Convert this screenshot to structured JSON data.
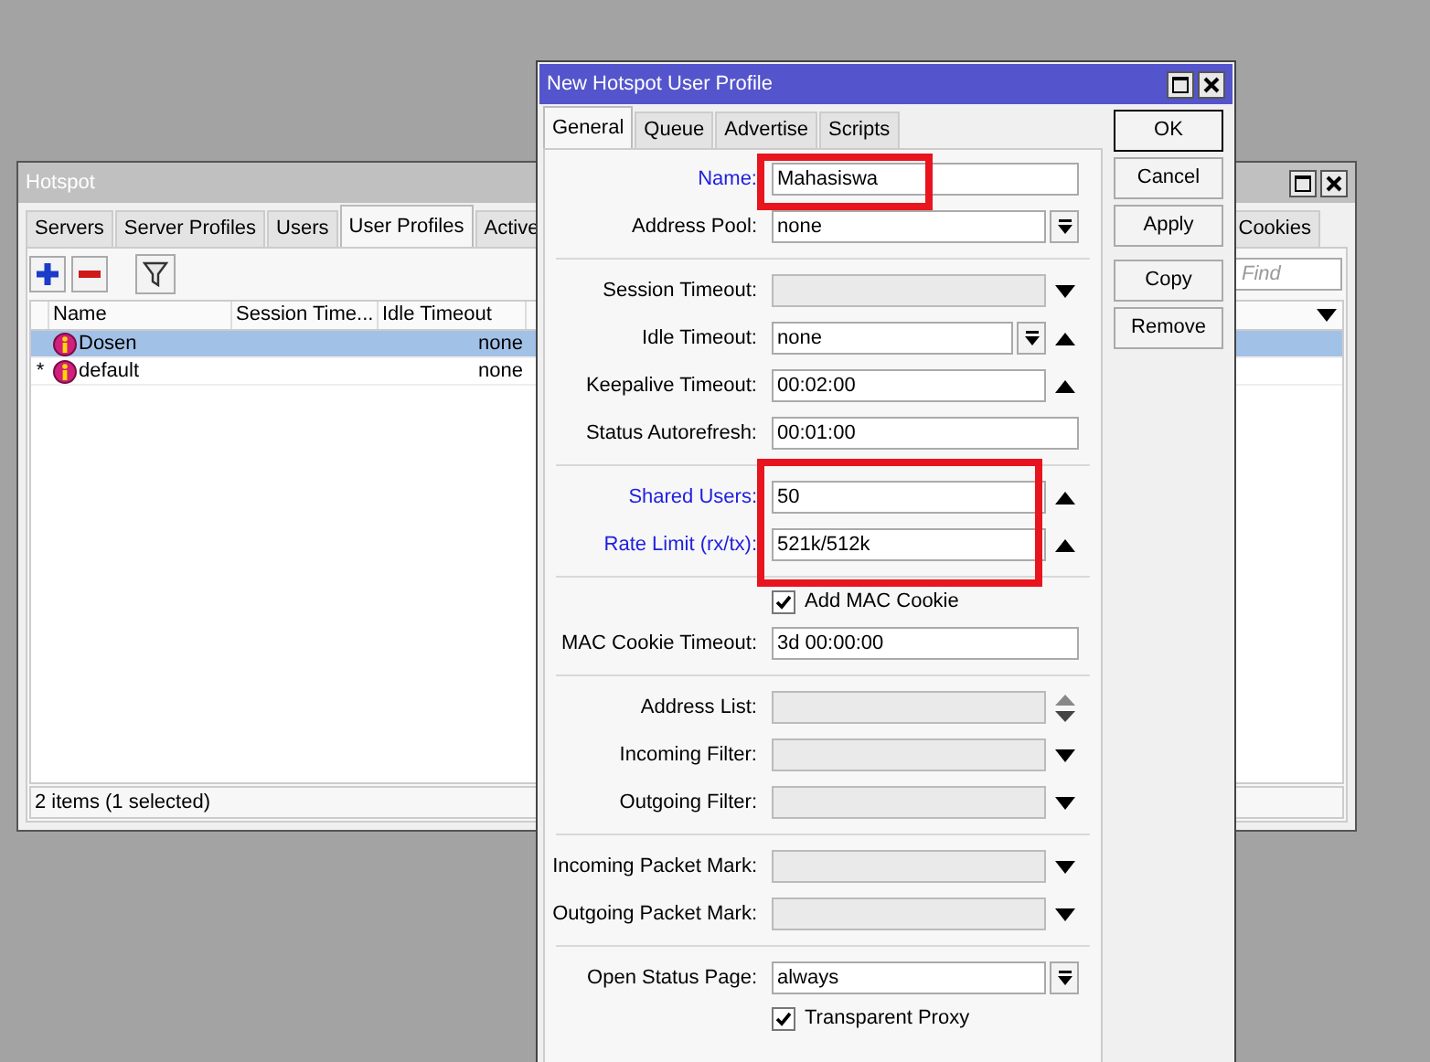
{
  "hotspot_window": {
    "title": "Hotspot",
    "tabs": [
      {
        "label": "Servers",
        "selected": false
      },
      {
        "label": "Server Profiles",
        "selected": false
      },
      {
        "label": "Users",
        "selected": false
      },
      {
        "label": "User Profiles",
        "selected": true
      },
      {
        "label": "Active",
        "selected": false
      },
      {
        "label": "Cookies",
        "selected": false
      }
    ],
    "find": {
      "placeholder": "Find"
    },
    "columns": [
      "Name",
      "Session Time...",
      "Idle Timeout"
    ],
    "rows": [
      {
        "name": "Dosen",
        "idle_timeout": "none",
        "selected": true
      },
      {
        "marker": "*",
        "name": "default",
        "idle_timeout": "none",
        "selected": false
      }
    ],
    "status": "2 items (1 selected)"
  },
  "dialog": {
    "title": "New Hotspot User Profile",
    "tabs": [
      {
        "label": "General",
        "selected": true
      },
      {
        "label": "Queue",
        "selected": false
      },
      {
        "label": "Advertise",
        "selected": false
      },
      {
        "label": "Scripts",
        "selected": false
      }
    ],
    "sections": [
      {
        "fields": [
          {
            "kind": "field",
            "label": "Name:",
            "modified": true,
            "value": "Mahasiswa",
            "enabled": true,
            "dropdown": false,
            "up_arrow": false,
            "down_arrow": false
          },
          {
            "kind": "field",
            "label": "Address Pool:",
            "modified": false,
            "value": "none",
            "enabled": true,
            "dropdown": true,
            "up_arrow": false,
            "down_arrow": false
          }
        ]
      },
      {
        "fields": [
          {
            "kind": "field",
            "label": "Session Timeout:",
            "modified": false,
            "enabled": false,
            "dropdown": false,
            "up_arrow": false,
            "down_arrow": true
          },
          {
            "kind": "field",
            "label": "Idle Timeout:",
            "modified": false,
            "value": "none",
            "enabled": true,
            "dropdown": true,
            "up_arrow": true,
            "down_arrow": false
          },
          {
            "kind": "field",
            "label": "Keepalive Timeout:",
            "modified": false,
            "value": "00:02:00",
            "enabled": true,
            "dropdown": false,
            "up_arrow": true,
            "down_arrow": false
          },
          {
            "kind": "field",
            "label": "Status Autorefresh:",
            "modified": false,
            "value": "00:01:00",
            "enabled": true,
            "dropdown": false,
            "up_arrow": false,
            "down_arrow": false
          }
        ]
      },
      {
        "fields": [
          {
            "kind": "field",
            "label": "Shared Users:",
            "modified": true,
            "value": "50",
            "enabled": true,
            "dropdown": false,
            "up_arrow": true,
            "down_arrow": false
          },
          {
            "kind": "field",
            "label": "Rate Limit (rx/tx):",
            "modified": true,
            "value": "521k/512k",
            "enabled": true,
            "dropdown": false,
            "up_arrow": true,
            "down_arrow": false
          }
        ]
      },
      {
        "fields": [
          {
            "kind": "checkbox",
            "label": "Add MAC Cookie",
            "checked": true
          },
          {
            "kind": "field",
            "label": "MAC Cookie Timeout:",
            "modified": false,
            "value": "3d 00:00:00",
            "enabled": true,
            "dropdown": false,
            "up_arrow": false,
            "down_arrow": false
          }
        ]
      },
      {
        "fields": [
          {
            "kind": "field",
            "label": "Address List:",
            "modified": false,
            "enabled": false,
            "dropdown": false,
            "up_arrow": true,
            "down_arrow": true
          },
          {
            "kind": "field",
            "label": "Incoming Filter:",
            "modified": false,
            "enabled": false,
            "dropdown": false,
            "up_arrow": false,
            "down_arrow": true
          },
          {
            "kind": "field",
            "label": "Outgoing Filter:",
            "modified": false,
            "enabled": false,
            "dropdown": false,
            "up_arrow": false,
            "down_arrow": true
          }
        ]
      },
      {
        "fields": [
          {
            "kind": "field",
            "label": "Incoming Packet Mark:",
            "modified": false,
            "enabled": false,
            "dropdown": false,
            "up_arrow": false,
            "down_arrow": true
          },
          {
            "kind": "field",
            "label": "Outgoing Packet Mark:",
            "modified": false,
            "enabled": false,
            "dropdown": false,
            "up_arrow": false,
            "down_arrow": true
          }
        ]
      },
      {
        "fields": [
          {
            "kind": "field",
            "label": "Open Status Page:",
            "modified": false,
            "value": "always",
            "enabled": true,
            "dropdown": true,
            "up_arrow": false,
            "down_arrow": false
          },
          {
            "kind": "checkbox",
            "label": "Transparent Proxy",
            "checked": true
          }
        ]
      }
    ],
    "button_groups": [
      [
        {
          "label": "OK",
          "default": true
        },
        {
          "label": "Cancel",
          "default": false
        },
        {
          "label": "Apply",
          "default": false
        }
      ],
      [
        {
          "label": "Copy",
          "default": false
        },
        {
          "label": "Remove",
          "default": false
        }
      ]
    ]
  }
}
